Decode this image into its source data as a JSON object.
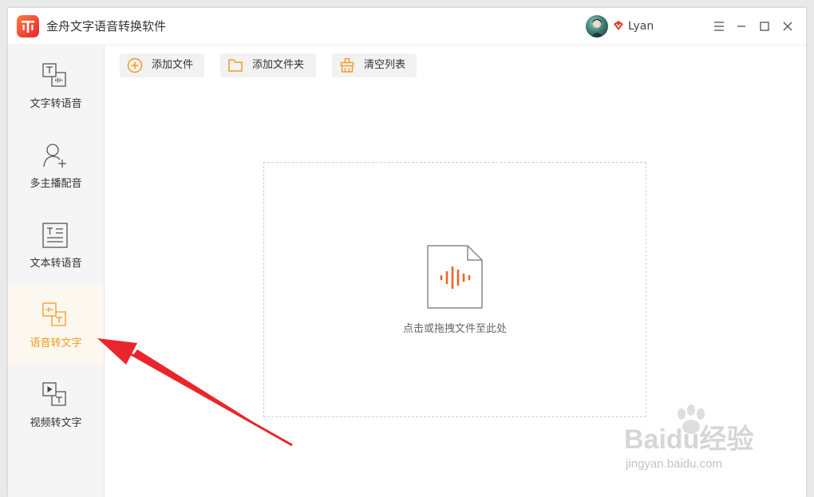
{
  "window": {
    "title": "金舟文字语音转换软件",
    "user": {
      "name": "Lyan"
    }
  },
  "sidebar": {
    "items": [
      {
        "label": "文字转语音",
        "icon": "text-to-speech-icon",
        "active": false
      },
      {
        "label": "多主播配音",
        "icon": "add-user-icon",
        "active": false
      },
      {
        "label": "文本转语音",
        "icon": "document-text-icon",
        "active": false
      },
      {
        "label": "语音转文字",
        "icon": "speech-to-text-icon",
        "active": true
      },
      {
        "label": "视频转文字",
        "icon": "video-to-text-icon",
        "active": false
      }
    ]
  },
  "toolbar": {
    "add_file": "添加文件",
    "add_folder": "添加文件夹",
    "clear_list": "清空列表"
  },
  "dropzone": {
    "hint": "点击或拖拽文件至此处"
  },
  "watermark": {
    "main": "Baidu经验",
    "sub": "jingyan.baidu.com"
  },
  "colors": {
    "accent": "#f39a1e",
    "annotation_arrow": "#e8262b",
    "audio_wave": "#f0632a"
  }
}
